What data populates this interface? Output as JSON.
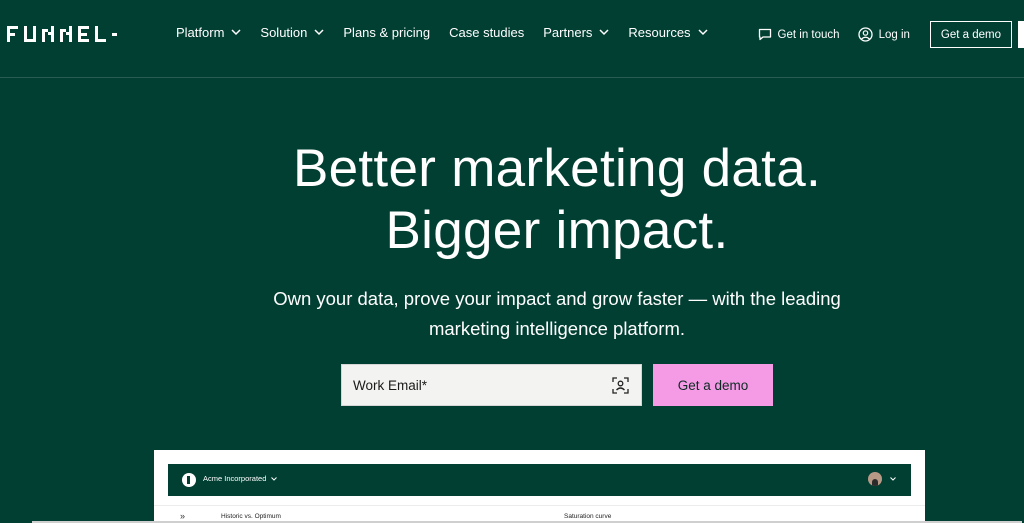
{
  "brand": {
    "logo_text": "FUNNEL"
  },
  "nav": {
    "items": [
      {
        "label": "Platform",
        "dropdown": true
      },
      {
        "label": "Solution",
        "dropdown": true
      },
      {
        "label": "Plans & pricing",
        "dropdown": false
      },
      {
        "label": "Case studies",
        "dropdown": false
      },
      {
        "label": "Partners",
        "dropdown": true
      },
      {
        "label": "Resources",
        "dropdown": true
      }
    ],
    "get_in_touch": "Get in touch",
    "log_in": "Log in",
    "get_demo": "Get a demo"
  },
  "hero": {
    "title_line1": "Better marketing data.",
    "title_line2": "Bigger impact.",
    "subtitle_line1": "Own your data, prove your impact and grow faster — with the leading",
    "subtitle_line2": "marketing intelligence platform.",
    "email_placeholder": "Work Email*",
    "cta": "Get a demo"
  },
  "preview": {
    "company": "Acme Incorporated",
    "expand": "»",
    "label_left": "Historic vs. Optimum",
    "label_right": "Saturation curve"
  },
  "colors": {
    "background": "#023f33",
    "cta": "#f59be6",
    "text": "#ffffff"
  }
}
